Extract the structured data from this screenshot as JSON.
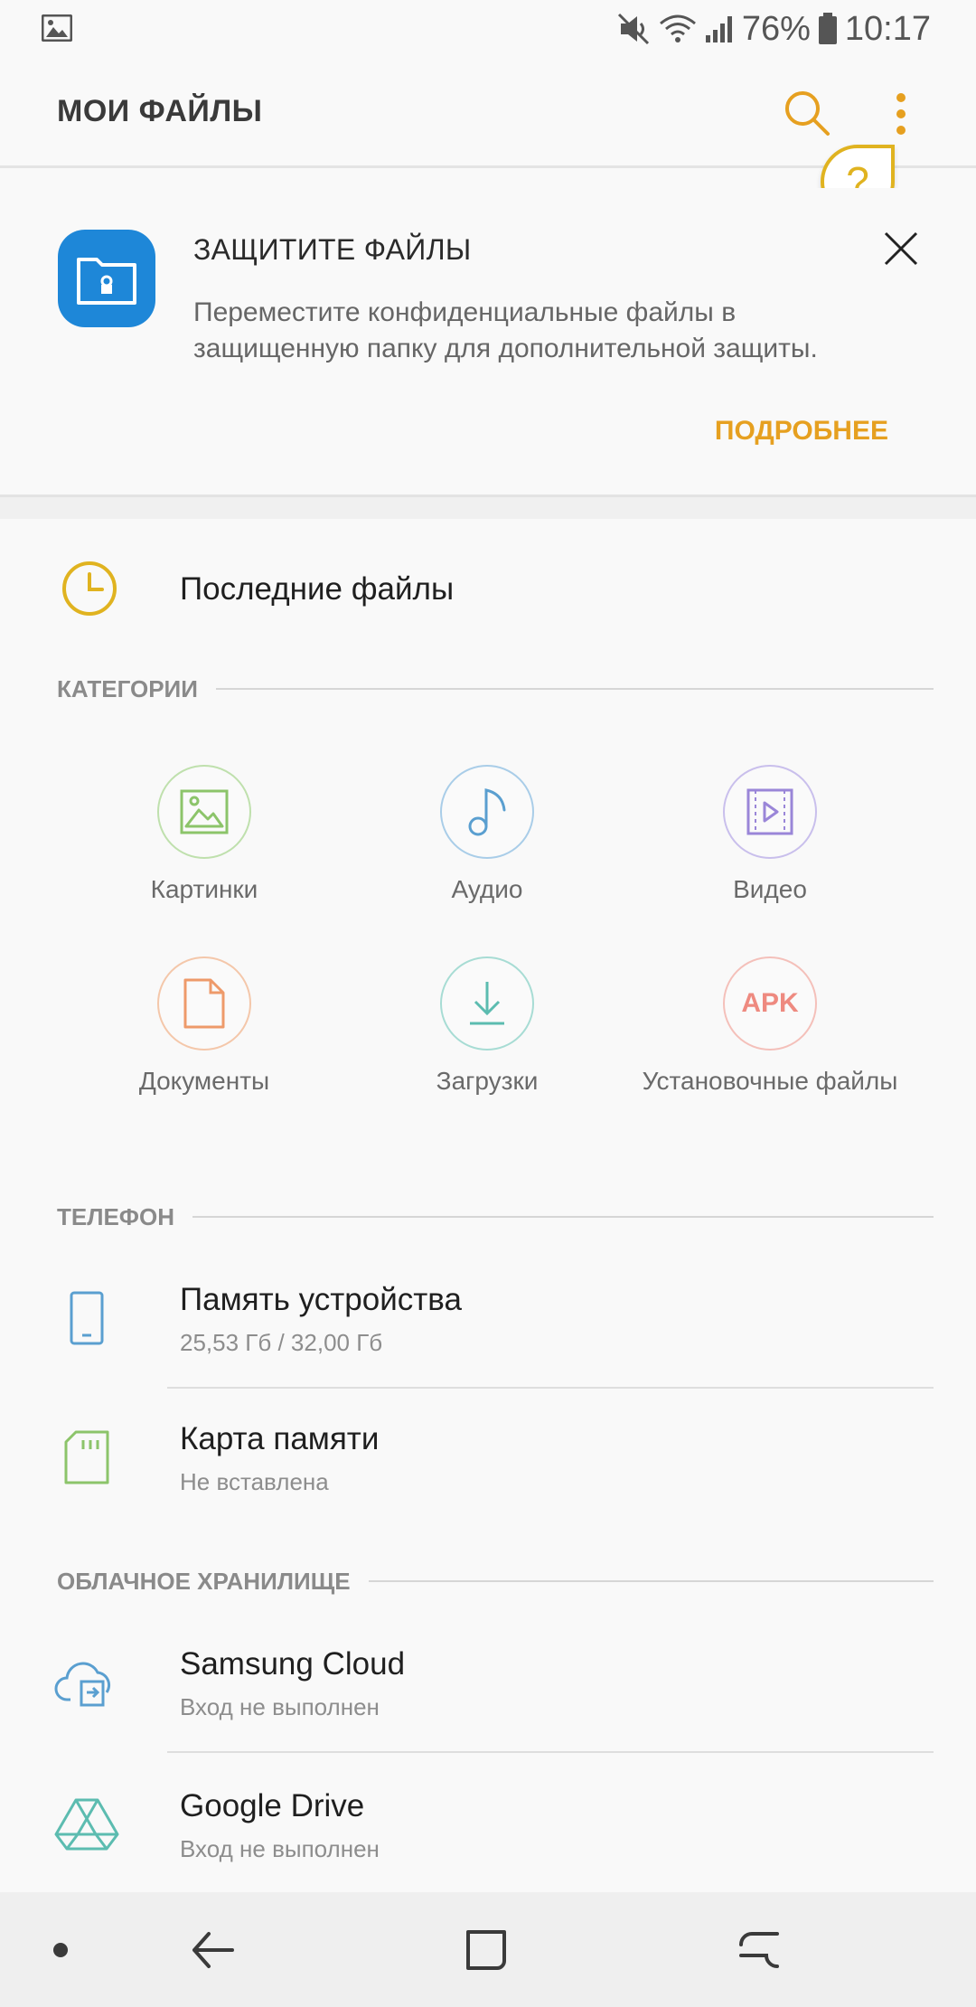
{
  "status_bar": {
    "battery_percent": "76%",
    "time": "10:17",
    "icons": [
      "gallery-notification-icon",
      "mute-icon",
      "wifi-icon",
      "signal-icon",
      "battery-icon"
    ]
  },
  "app_bar": {
    "title": "МОИ ФАЙЛЫ",
    "help_glyph": "?"
  },
  "promo": {
    "title": "ЗАЩИТИТЕ ФАЙЛЫ",
    "text": "Переместите конфиденциальные файлы в защищенную папку для дополнительной защиты.",
    "more_label": "ПОДРОБНЕЕ"
  },
  "recent": {
    "label": "Последние файлы"
  },
  "categories": {
    "header": "КАТЕГОРИИ",
    "items": [
      {
        "label": "Картинки",
        "color": "#8cc46a",
        "icon": "image-icon"
      },
      {
        "label": "Аудио",
        "color": "#5a9fd0",
        "icon": "music-note-icon"
      },
      {
        "label": "Видео",
        "color": "#9a86d8",
        "icon": "video-icon"
      },
      {
        "label": "Документы",
        "color": "#ee9a6a",
        "icon": "document-icon"
      },
      {
        "label": "Загрузки",
        "color": "#5cbcb0",
        "icon": "download-icon"
      },
      {
        "label": "Установочные файлы",
        "color": "#ee8a80",
        "icon": "apk-icon",
        "badge": "APK"
      }
    ]
  },
  "phone": {
    "header": "ТЕЛЕФОН",
    "items": [
      {
        "title": "Память устройства",
        "subtitle": "25,53 Гб / 32,00 Гб"
      },
      {
        "title": "Карта памяти",
        "subtitle": "Не вставлена"
      }
    ]
  },
  "cloud": {
    "header": "ОБЛАЧНОЕ ХРАНИЛИЩЕ",
    "items": [
      {
        "title": "Samsung Cloud",
        "subtitle": "Вход не выполнен"
      },
      {
        "title": "Google Drive",
        "subtitle": "Вход не выполнен"
      }
    ]
  },
  "colors": {
    "accent": "#e6a020",
    "help_yellow": "#e0b320",
    "promo_icon_blue": "#1e87d8"
  }
}
